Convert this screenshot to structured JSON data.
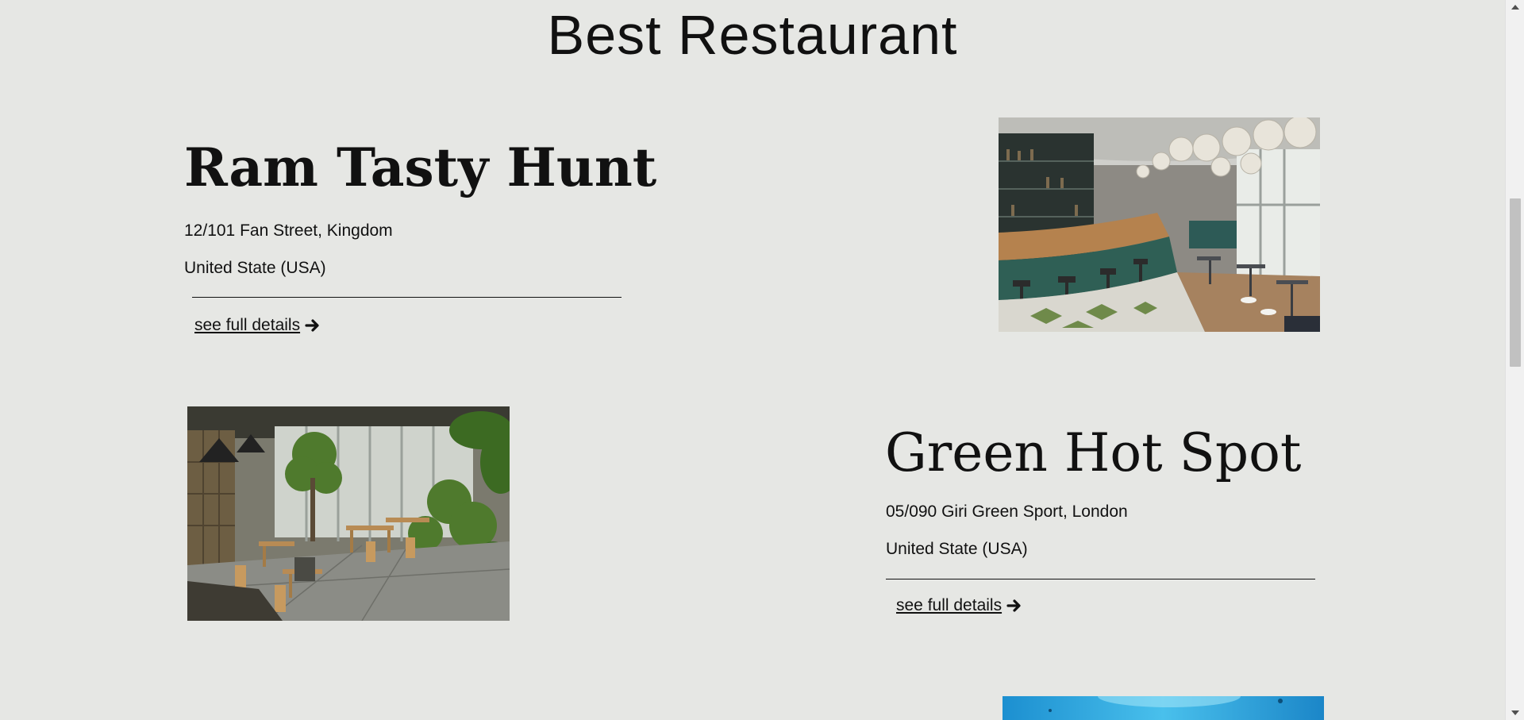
{
  "page": {
    "title": "Best Restaurant"
  },
  "restaurants": [
    {
      "name": "Ram Tasty Hunt",
      "address": "12/101 Fan Street, Kingdom",
      "country": "United State (USA)",
      "link_label": "see full details ",
      "image": "restaurant-bar-interior-photo"
    },
    {
      "name": "Green Hot Spot",
      "address": "05/090 Giri Green Sport, London",
      "country": "United State (USA)",
      "link_label": "see full details ",
      "image": "restaurant-garden-interior-photo"
    },
    {
      "image": "underwater-restaurant-photo"
    }
  ],
  "icons": {
    "link_arrow": "arrow-right-icon"
  },
  "colors": {
    "background": "#e6e7e4",
    "text": "#111111"
  }
}
